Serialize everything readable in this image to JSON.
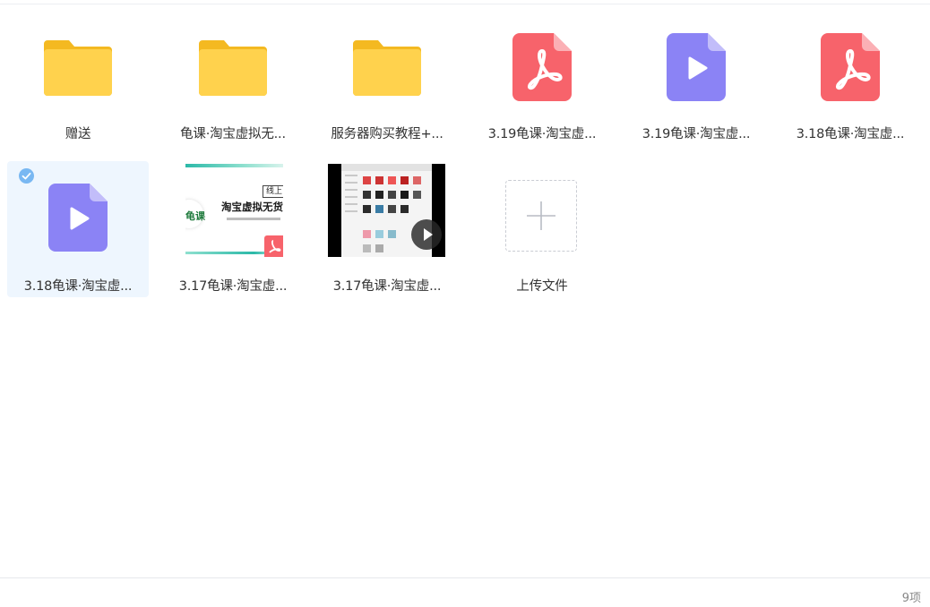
{
  "files": [
    {
      "name": "赠送",
      "type": "folder"
    },
    {
      "name": "龟课·淘宝虚拟无...",
      "type": "folder"
    },
    {
      "name": "服务器购买教程+...",
      "type": "folder"
    },
    {
      "name": "3.19龟课·淘宝虚...",
      "type": "pdf"
    },
    {
      "name": "3.19龟课·淘宝虚...",
      "type": "video"
    },
    {
      "name": "3.18龟课·淘宝虚...",
      "type": "pdf"
    },
    {
      "name": "3.18龟课·淘宝虚...",
      "type": "video",
      "selected": true
    },
    {
      "name": "3.17龟课·淘宝虚...",
      "type": "pdf-thumbnail"
    },
    {
      "name": "3.17龟课·淘宝虚...",
      "type": "video-thumbnail"
    }
  ],
  "upload": {
    "label": "上传文件"
  },
  "thumbnail_doc": {
    "tag": "线上",
    "title": "淘宝虚拟无货",
    "logo": "龟课"
  },
  "status": {
    "count": "9项"
  },
  "colors": {
    "folder": "#ffd24d",
    "pdf": "#f7636b",
    "video": "#8b83f5",
    "selected_bg": "#eef6fe",
    "check": "#79b8f2"
  }
}
